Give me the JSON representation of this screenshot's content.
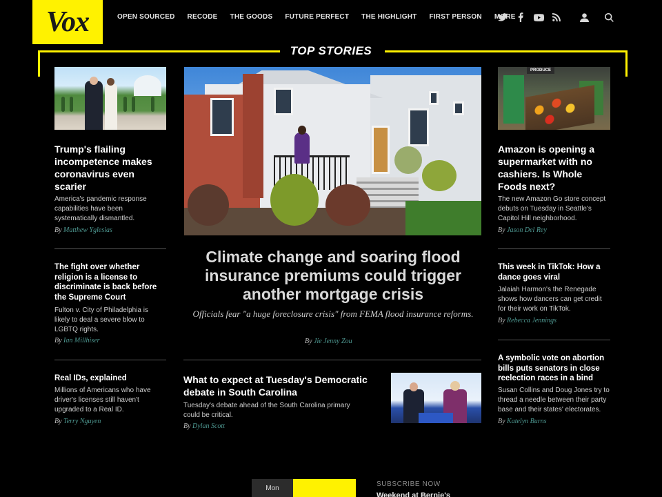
{
  "logo": "Vox",
  "nav": {
    "items": [
      "OPEN SOURCED",
      "RECODE",
      "THE GOODS",
      "FUTURE PERFECT",
      "THE HIGHLIGHT",
      "FIRST PERSON",
      "MORE"
    ]
  },
  "social": [
    "twitter-icon",
    "facebook-icon",
    "youtube-icon",
    "rss-icon"
  ],
  "section_title": "TOP STORIES",
  "colors": {
    "accent": "#fff200",
    "byline_link": "#4f9a93",
    "background": "#000000"
  },
  "stories": {
    "left1": {
      "headline": "Trump's flailing incompetence makes coronavirus even scarier",
      "dek": "America's pandemic response capabilities have been systematically dismantled.",
      "by": "By",
      "author": "Matthew Yglesias"
    },
    "left2": {
      "headline": "The fight over whether religion is a license to discriminate is back before the Supreme Court",
      "dek": "Fulton v. City of Philadelphia is likely to deal a severe blow to LGBTQ rights.",
      "by": "By",
      "author": "Ian Millhiser"
    },
    "left3": {
      "headline": "Real IDs, explained",
      "dek": "Millions of Americans who have driver's licenses still haven't upgraded to a Real ID.",
      "by": "By",
      "author": "Terry Nguyen"
    },
    "main": {
      "headline": "Climate change and soaring flood insurance premiums could trigger another mortgage crisis",
      "dek": "Officials fear \"a huge foreclosure crisis\" from FEMA flood insurance reforms.",
      "by": "By",
      "author": "Jie Jenny Zou"
    },
    "center2": {
      "headline": "What to expect at Tuesday's Democratic debate in South Carolina",
      "dek": "Tuesday's debate ahead of the South Carolina primary could be critical.",
      "by": "By",
      "author": "Dylan Scott"
    },
    "right1": {
      "headline": "Amazon is opening a supermarket with no cashiers. Is Whole Foods next?",
      "dek": "The new Amazon Go store concept debuts on Tuesday in Seattle's Capitol Hill neighborhood.",
      "by": "By",
      "author": "Jason Del Rey",
      "image_sign": "PRODUCE"
    },
    "right2": {
      "headline": "This week in TikTok: How a dance goes viral",
      "dek": "Jalaiah Harmon's the Renegade shows how dancers can get credit for their work on TikTok.",
      "by": "By",
      "author": "Rebecca Jennings"
    },
    "right3": {
      "headline": "A symbolic vote on abortion bills puts senators in close reelection races in a bind",
      "dek": "Susan Collins and Doug Jones try to thread a needle between their party base and their states' electorates.",
      "by": "By",
      "author": "Katelyn Burns"
    }
  },
  "bottom": {
    "tabs": [
      "Mon",
      ""
    ],
    "subscribe_label": "SUBSCRIBE NOW",
    "subscribe_headline": "Weekend at Bernie's"
  }
}
